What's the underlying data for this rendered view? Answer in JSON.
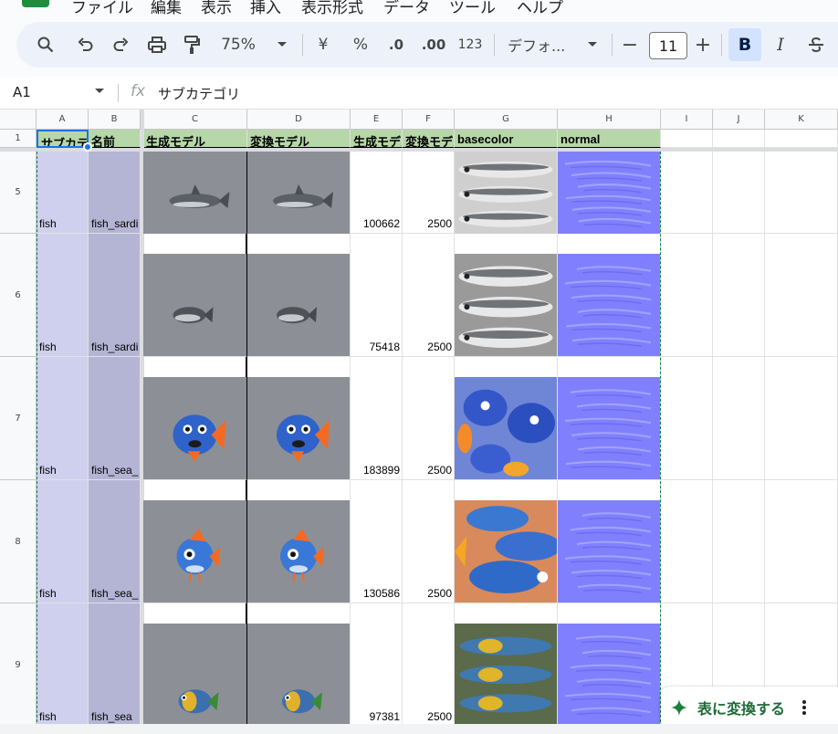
{
  "menu": [
    "ファイル",
    "編集",
    "表示",
    "挿入",
    "表示形式",
    "データ",
    "ツール",
    "ヘルプ"
  ],
  "toolbar": {
    "zoom": "75%",
    "currency": "¥",
    "percent": "%",
    "dec_decrease": ".0",
    "dec_increase": ".00",
    "number_format": "123",
    "font": "デフォ...",
    "font_size": "11",
    "minus": "−",
    "plus": "+",
    "bold": "B",
    "italic": "I"
  },
  "formula_bar": {
    "cell_ref": "A1",
    "fx": "fx",
    "value": "サブカテゴリ"
  },
  "columns": [
    "A",
    "B",
    "C",
    "D",
    "E",
    "F",
    "G",
    "H",
    "I",
    "J",
    "K"
  ],
  "header_row": {
    "row_number": "1",
    "cells": [
      "サブカテゴリ",
      "名前",
      "生成モデル",
      "変換モデル",
      "生成モデル",
      "変換モデル",
      "basecolor",
      "normal"
    ]
  },
  "rows": [
    {
      "row_number": "5",
      "subcategory": "fish",
      "name": "fish_sardi",
      "generated": "100662",
      "converted": "2500",
      "fish_style": "shark"
    },
    {
      "row_number": "6",
      "subcategory": "fish",
      "name": "fish_sardi",
      "generated": "75418",
      "converted": "2500",
      "fish_style": "silver"
    },
    {
      "row_number": "7",
      "subcategory": "fish",
      "name": "fish_sea_",
      "generated": "183899",
      "converted": "2500",
      "fish_style": "bluefront"
    },
    {
      "row_number": "8",
      "subcategory": "fish",
      "name": "fish_sea_",
      "generated": "130586",
      "converted": "2500",
      "fish_style": "bluespotted"
    },
    {
      "row_number": "9",
      "subcategory": "fish",
      "name": "fish_sea",
      "generated": "97381",
      "converted": "2500",
      "fish_style": "tropical"
    }
  ],
  "convert_button": {
    "label": "表に変換する",
    "icon": "sparkle-icon"
  },
  "colors": {
    "header_fill": "#b6d7a8",
    "col_a_fill": "#cfcfee",
    "col_b_fill": "#b4b4d4",
    "bold_active": "#d3e3fd",
    "accent_green": "#1e6b37"
  }
}
